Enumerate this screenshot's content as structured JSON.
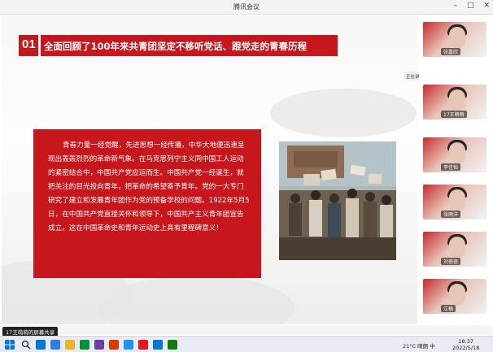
{
  "window": {
    "title": "腾讯会议"
  },
  "slide": {
    "section_number": "01",
    "heading": "全面回顾了100年来共青团坚定不移听党话、跟党走的青春历程",
    "body": "青春力量一经觉醒，先进思想一经传播，中华大地便迅速呈现出轰轰烈烈的革命新气象。在马克思列宁主义同中国工人运动的紧密结合中，中国共产党应运而生。中国共产党一经诞生，就把关注的目光投向青年，把革命的希望寄予青年。党的一大专门研究了建立和发展青年团作为党的预备学校的问题。1922年5月5日，在中国共产党直接关怀和领导下，中国共产主义青年团宣告成立。这在中国革命史和青年运动史上具有里程碑意义！"
  },
  "participants": [
    {
      "name": "张嘉欣"
    },
    {
      "name": "17王萌萌"
    },
    {
      "name": "李佳怡"
    },
    {
      "name": "张雨洋"
    },
    {
      "name": "刘蓓蓓"
    },
    {
      "name": "江楠"
    }
  ],
  "speaking_indicator": "正在讲话: 17王萌萌",
  "share_indicator": "17王萌萌的屏幕共享",
  "taskbar": {
    "weather": "21°C 晴朗",
    "input_method": "中",
    "time": "18:37",
    "date": "2022/5/18",
    "icon_colors": [
      "#0078d4",
      "#2b7de9",
      "#f0b429",
      "#0a8f3c",
      "#6b3fa0",
      "#d83b01",
      "#1e90ff",
      "#e81123",
      "#0078d4",
      "#107c10"
    ]
  },
  "colors": {
    "accent_red": "#c8161d"
  }
}
